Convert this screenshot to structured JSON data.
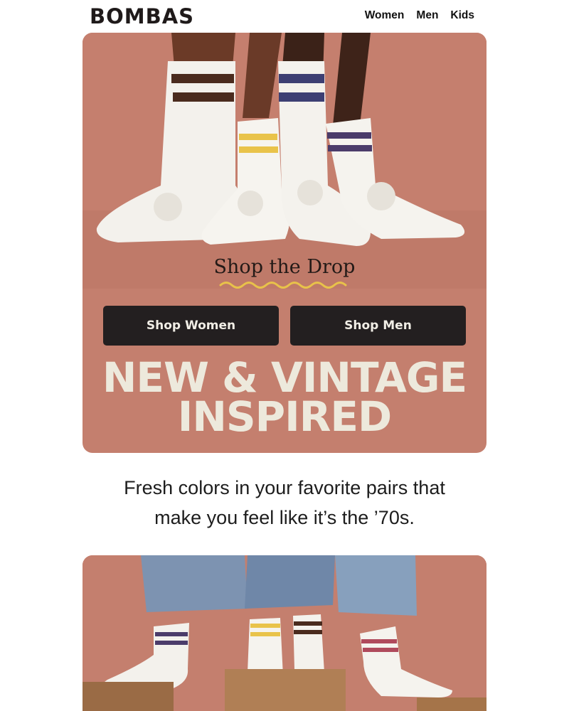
{
  "header": {
    "logo": "BOMBAS",
    "nav": [
      "Women",
      "Men",
      "Kids"
    ]
  },
  "hero": {
    "title": "Shop the Drop",
    "buttons": {
      "women": "Shop Women",
      "men": "Shop Men"
    },
    "headline_line1": "NEW & VINTAGE",
    "headline_line2": "INSPIRED",
    "image_alt": "Legs wearing white socks with colored stripes"
  },
  "body": {
    "line1": "Fresh colors in your favorite pairs that",
    "line2": "make you feel like it’s the ’70s."
  },
  "second_banner": {
    "image_alt": "Legs in jeans wearing striped socks on wooden blocks"
  },
  "colors": {
    "background": "#ffffff",
    "hero_bg": "#c47f6e",
    "button_bg": "#231f20",
    "button_text": "#f1eee6",
    "headline": "#ede9dc",
    "wave": "#e8c24a",
    "stripe_brown": "#4a2b1e",
    "stripe_yellow": "#e9c34a",
    "stripe_navy": "#3d3f73",
    "stripe_purple": "#4b3c6a",
    "stripe_pink": "#b04a5c"
  }
}
